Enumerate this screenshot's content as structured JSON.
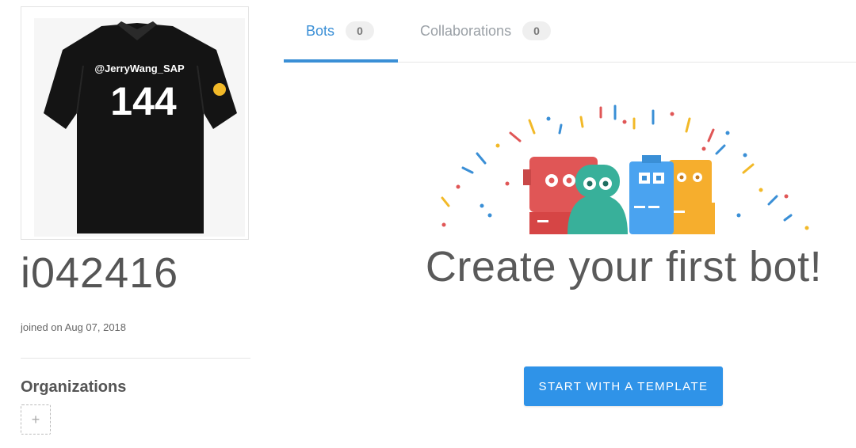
{
  "profile": {
    "avatar": {
      "shirt_handle": "@JerryWang_SAP",
      "shirt_number": "144"
    },
    "username": "i042416",
    "joined": "joined on Aug 07, 2018",
    "organizations_title": "Organizations",
    "add_org_symbol": "+"
  },
  "tabs": [
    {
      "label": "Bots",
      "count": "0",
      "active": true
    },
    {
      "label": "Collaborations",
      "count": "0",
      "active": false
    }
  ],
  "main": {
    "headline": "Create your first bot!",
    "cta_label": "START WITH A TEMPLATE"
  },
  "colors": {
    "accent": "#3a8fd6",
    "button": "#2f93e8"
  }
}
